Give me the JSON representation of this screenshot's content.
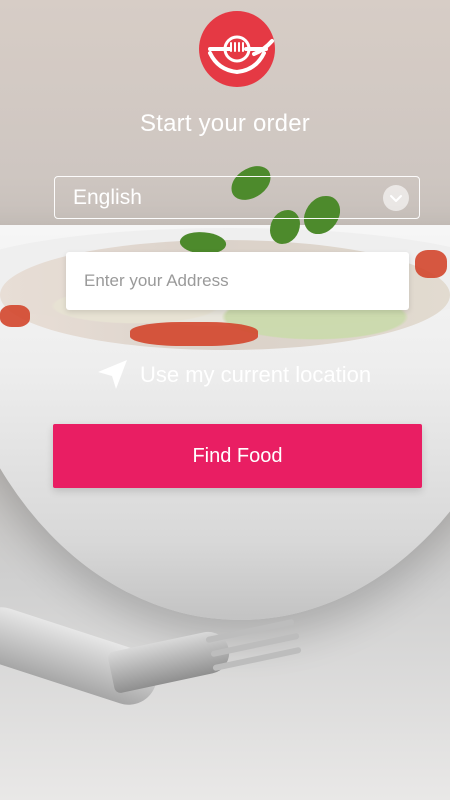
{
  "brand": {
    "logo_icon": "fork-plate-icon",
    "accent_color": "#e91e63"
  },
  "header": {
    "title": "Start your order"
  },
  "language_select": {
    "selected": "English",
    "icon": "chevron-down-icon"
  },
  "address": {
    "placeholder": "Enter your Address",
    "value": ""
  },
  "location": {
    "label": "Use my current location",
    "icon": "navigation-arrow-icon"
  },
  "actions": {
    "find_food": "Find Food"
  }
}
